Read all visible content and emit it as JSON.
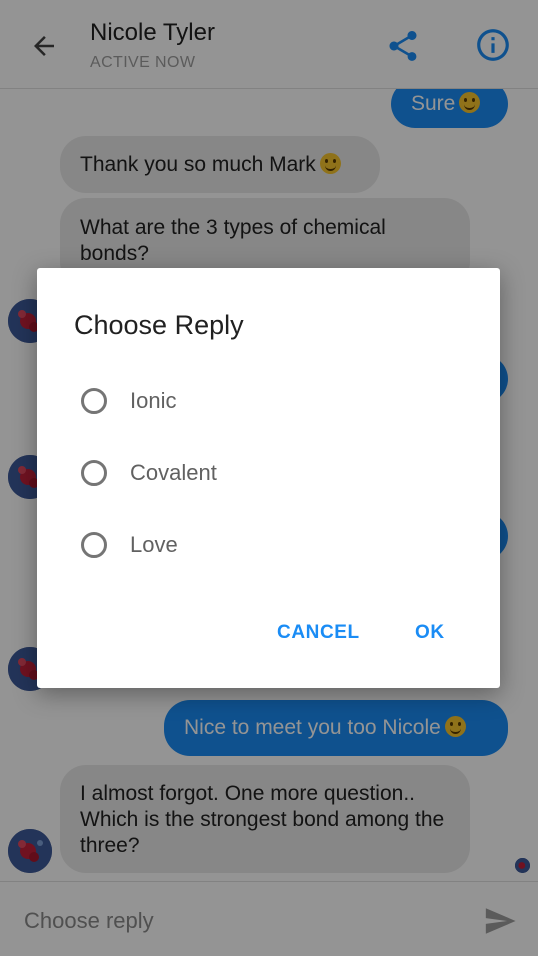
{
  "header": {
    "contact_name": "Nicole Tyler",
    "status": "ACTIVE NOW",
    "back_icon": "arrow-left-icon",
    "share_icon": "share-icon",
    "info_icon": "info-icon",
    "accent_color": "#1a8cf5"
  },
  "chat": {
    "messages": [
      {
        "from": "me",
        "text": "Sure",
        "emoji": true
      },
      {
        "from": "them",
        "text": "Thank you so much Mark",
        "emoji": true
      },
      {
        "from": "them",
        "text": "What are the 3 types of chemical bonds?"
      },
      {
        "from": "me",
        "text": "Nice to meet you too Nicole",
        "emoji": true
      },
      {
        "from": "them",
        "text": "I almost forgot. One more question.. Which is the strongest bond among the three?"
      }
    ]
  },
  "dialog": {
    "title": "Choose Reply",
    "options": [
      "Ionic",
      "Covalent",
      "Love"
    ],
    "cancel_label": "CANCEL",
    "ok_label": "OK"
  },
  "input": {
    "placeholder": "Choose reply",
    "value": "",
    "send_icon": "send-icon"
  }
}
